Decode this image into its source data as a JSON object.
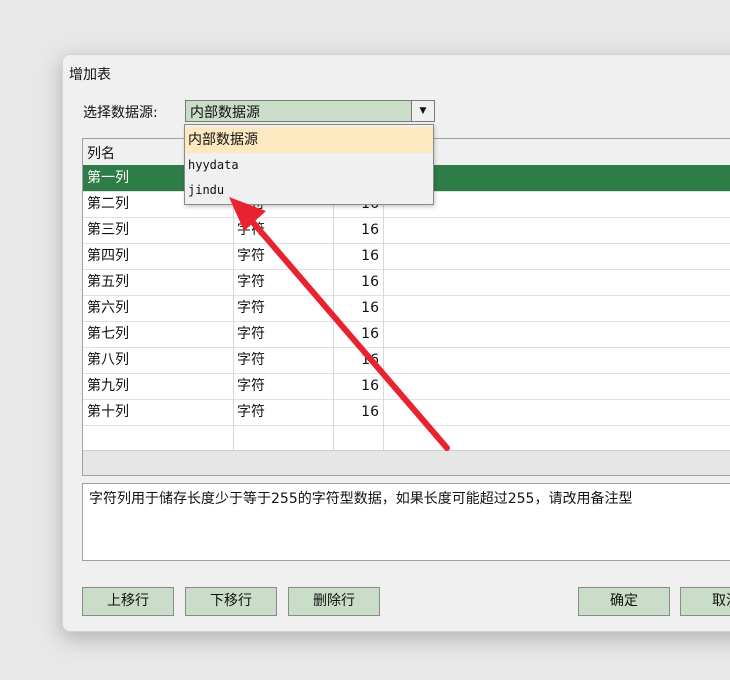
{
  "dialog": {
    "title": "增加表"
  },
  "datasource": {
    "label": "选择数据源:",
    "selected": "内部数据源",
    "options": [
      "内部数据源",
      "hyydata",
      "jindu"
    ]
  },
  "grid": {
    "header_name": "列名",
    "rows": [
      {
        "name": "第一列",
        "type": "",
        "len": ""
      },
      {
        "name": "第二列",
        "type": "字符",
        "len": "16"
      },
      {
        "name": "第三列",
        "type": "字符",
        "len": "16"
      },
      {
        "name": "第四列",
        "type": "字符",
        "len": "16"
      },
      {
        "name": "第五列",
        "type": "字符",
        "len": "16"
      },
      {
        "name": "第六列",
        "type": "字符",
        "len": "16"
      },
      {
        "name": "第七列",
        "type": "字符",
        "len": "16"
      },
      {
        "name": "第八列",
        "type": "字符",
        "len": "16"
      },
      {
        "name": "第九列",
        "type": "字符",
        "len": "16"
      },
      {
        "name": "第十列",
        "type": "字符",
        "len": "16"
      }
    ]
  },
  "description": "字符列用于储存长度少于等于255的字符型数据，如果长度可能超过255，请改用备注型",
  "buttons": {
    "move_up": "上移行",
    "move_down": "下移行",
    "delete_row": "删除行",
    "ok": "确定",
    "cancel": "取消"
  },
  "colors": {
    "accent": "#2e7d48",
    "button": "#c9ddc9",
    "highlight": "#fde8c0",
    "annotation": "#e8232f"
  }
}
